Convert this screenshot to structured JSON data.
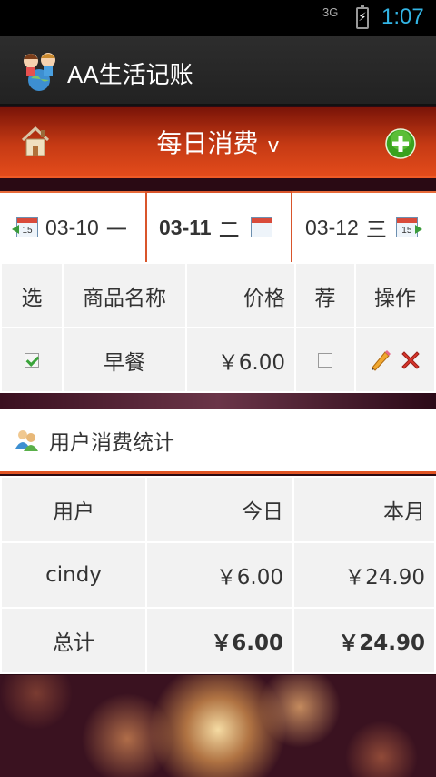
{
  "status_bar": {
    "network": "3G",
    "time": "1:07"
  },
  "action_bar": {
    "title": "AA生活记账"
  },
  "header": {
    "title": "每日消费",
    "dropdown_indicator": "v"
  },
  "date_nav": {
    "prev": {
      "date": "03-10",
      "weekday": "一",
      "icon": "calendar-prev-icon",
      "icon_text": "15"
    },
    "current": {
      "date": "03-11",
      "weekday": "二",
      "icon": "calendar-icon"
    },
    "next": {
      "date": "03-12",
      "weekday": "三",
      "icon": "calendar-next-icon",
      "icon_text": "15"
    }
  },
  "items_table": {
    "headers": [
      "选",
      "商品名称",
      "价格",
      "荐",
      "操作"
    ],
    "rows": [
      {
        "selected": true,
        "name": "早餐",
        "price": "￥6.00",
        "recommended": false
      }
    ]
  },
  "stats": {
    "title": "用户消费统计",
    "headers": [
      "用户",
      "今日",
      "本月"
    ],
    "rows": [
      {
        "user": "cindy",
        "today": "￥6.00",
        "month": "￥24.90"
      }
    ],
    "total": {
      "label": "总计",
      "today": "￥6.00",
      "month": "￥24.90"
    }
  },
  "colors": {
    "accent": "#e05424",
    "header_gradient_start": "#7a1408",
    "status_time": "#33b5e5"
  }
}
